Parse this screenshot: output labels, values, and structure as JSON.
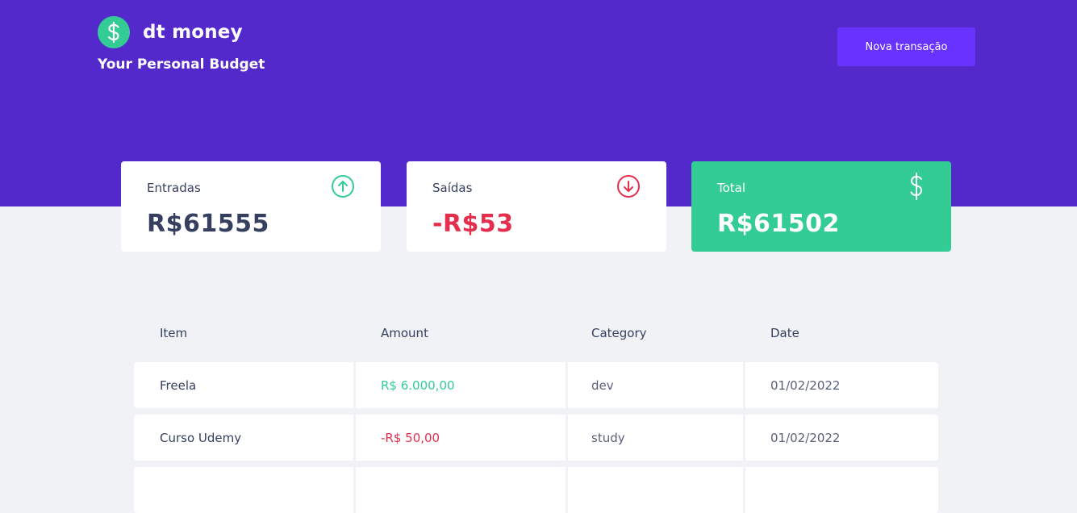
{
  "app": {
    "name": "dt money",
    "tagline": "Your Personal Budget",
    "new_button": "Nova transação"
  },
  "summary": {
    "income": {
      "label": "Entradas",
      "value": "R$61555",
      "icon": "arrow-up-circle-icon"
    },
    "outcome": {
      "label": "Saídas",
      "value": "-R$53",
      "icon": "arrow-down-circle-icon"
    },
    "total": {
      "label": "Total",
      "value": "R$61502",
      "icon": "dollar-icon"
    }
  },
  "table": {
    "headers": [
      "Item",
      "Amount",
      "Category",
      "Date"
    ],
    "rows": [
      {
        "item": "Freela",
        "amount": "R$ 6.000,00",
        "category": "dev",
        "date": "01/02/2022",
        "type": "deposit"
      },
      {
        "item": "Curso Udemy",
        "amount": "-R$ 50,00",
        "category": "study",
        "date": "01/02/2022",
        "type": "withdraw"
      }
    ]
  },
  "colors": {
    "header_bg": "#5429cc",
    "button_bg": "#6933ff",
    "green": "#33cc95",
    "red": "#e52e4d",
    "text": "#363f5f",
    "page_bg": "#f0f2f5"
  }
}
